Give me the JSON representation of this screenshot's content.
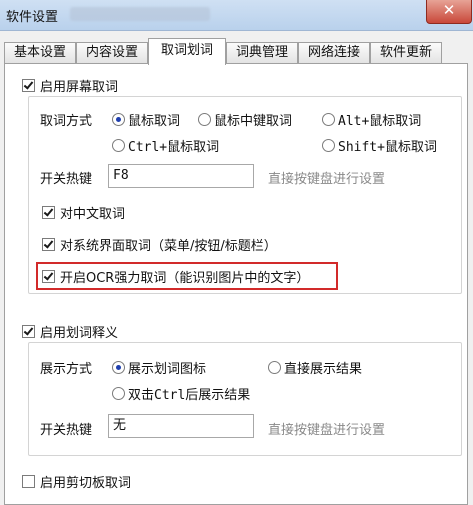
{
  "window": {
    "title": "软件设置",
    "close_glyph": "✕"
  },
  "tabs": [
    "基本设置",
    "内容设置",
    "取词划词",
    "词典管理",
    "网络连接",
    "软件更新"
  ],
  "screen_capture": {
    "enable_label": "启用屏幕取词",
    "method_label": "取词方式",
    "options": [
      "鼠标取词",
      "鼠标中键取词",
      "Alt+鼠标取词",
      "Ctrl+鼠标取词",
      "Shift+鼠标取词"
    ],
    "hotkey_label": "开关热键",
    "hotkey_value": "F8",
    "hotkey_hint": "直接按键盘进行设置",
    "chinese_label": "对中文取词",
    "system_ui_label": "对系统界面取词（菜单/按钮/标题栏）",
    "ocr_label": "开启OCR强力取词（能识别图片中的文字）"
  },
  "word_selection": {
    "enable_label": "启用划词释义",
    "display_label": "展示方式",
    "options": [
      "展示划词图标",
      "直接展示结果",
      "双击Ctrl后展示结果"
    ],
    "hotkey_label": "开关热键",
    "hotkey_value": "无",
    "hotkey_hint": "直接按键盘进行设置"
  },
  "clipboard": {
    "enable_label": "启用剪切板取词"
  },
  "colors": {
    "highlight": "#d22a2a",
    "radio_dot": "#1f3fae"
  }
}
